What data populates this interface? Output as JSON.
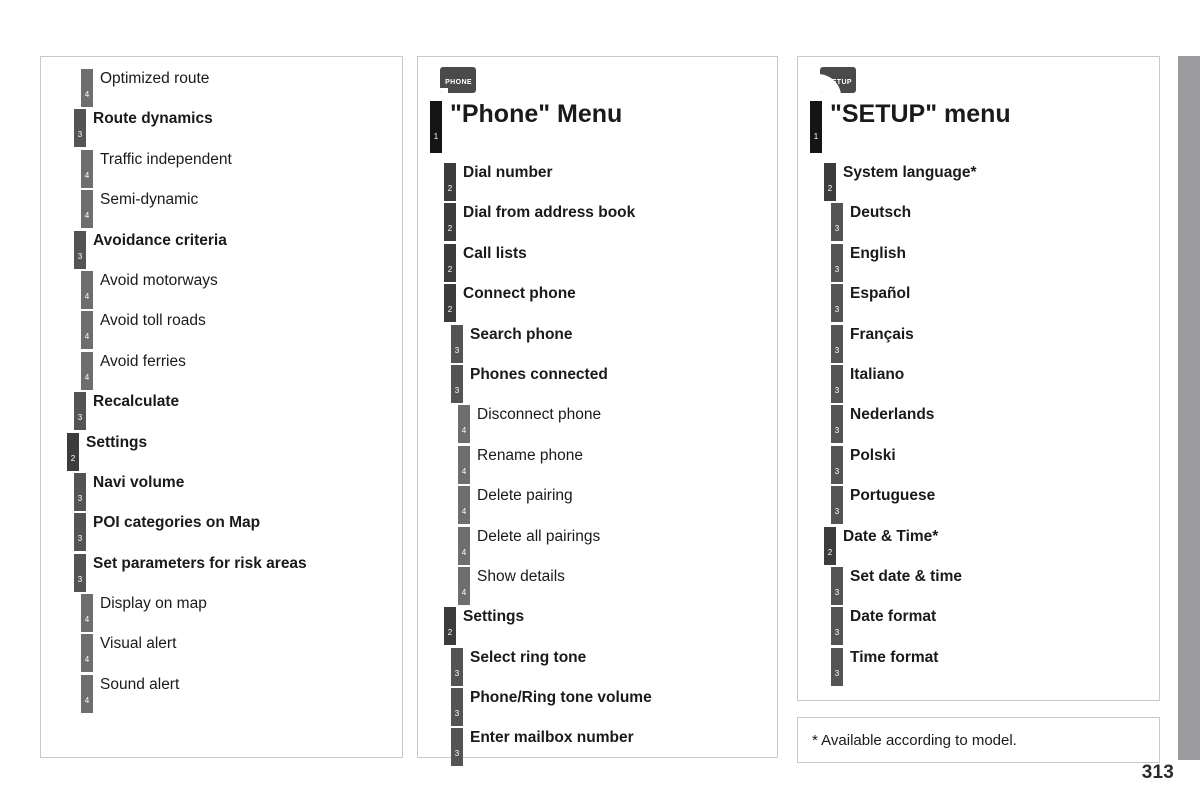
{
  "page": {
    "number": "313",
    "footnote": "* Available according to model."
  },
  "columns": [
    {
      "id": "navigation-continued",
      "icon": null,
      "rows": [
        {
          "level": 4,
          "label": "Optimized route"
        },
        {
          "level": 3,
          "label": "Route dynamics"
        },
        {
          "level": 4,
          "label": "Traffic independent"
        },
        {
          "level": 4,
          "label": "Semi-dynamic"
        },
        {
          "level": 3,
          "label": "Avoidance criteria"
        },
        {
          "level": 4,
          "label": "Avoid motorways"
        },
        {
          "level": 4,
          "label": "Avoid toll roads"
        },
        {
          "level": 4,
          "label": "Avoid ferries"
        },
        {
          "level": 3,
          "label": "Recalculate"
        },
        {
          "level": 2,
          "label": "Settings"
        },
        {
          "level": 3,
          "label": "Navi volume"
        },
        {
          "level": 3,
          "label": "POI categories on Map"
        },
        {
          "level": 3,
          "label": "Set parameters for risk areas"
        },
        {
          "level": 4,
          "label": "Display on map"
        },
        {
          "level": 4,
          "label": "Visual alert"
        },
        {
          "level": 4,
          "label": "Sound alert"
        }
      ]
    },
    {
      "id": "phone-menu",
      "icon": {
        "name": "phone-menu-icon",
        "glyph": "PHONE"
      },
      "rows": [
        {
          "level": 1,
          "label": "\"Phone\" Menu"
        },
        {
          "level": 2,
          "label": "Dial number"
        },
        {
          "level": 2,
          "label": "Dial from address book"
        },
        {
          "level": 2,
          "label": "Call lists"
        },
        {
          "level": 2,
          "label": "Connect phone"
        },
        {
          "level": 3,
          "label": "Search phone"
        },
        {
          "level": 3,
          "label": "Phones connected"
        },
        {
          "level": 4,
          "label": "Disconnect phone"
        },
        {
          "level": 4,
          "label": "Rename phone"
        },
        {
          "level": 4,
          "label": "Delete pairing"
        },
        {
          "level": 4,
          "label": "Delete all pairings"
        },
        {
          "level": 4,
          "label": "Show details"
        },
        {
          "level": 2,
          "label": "Settings"
        },
        {
          "level": 3,
          "label": "Select ring tone"
        },
        {
          "level": 3,
          "label": "Phone/Ring tone volume"
        },
        {
          "level": 3,
          "label": "Enter mailbox number"
        }
      ]
    },
    {
      "id": "setup-menu",
      "icon": {
        "name": "setup-menu-icon",
        "glyph": "SETUP"
      },
      "rows": [
        {
          "level": 1,
          "label": "\"SETUP\" menu"
        },
        {
          "level": 2,
          "label": "System language*"
        },
        {
          "level": 3,
          "label": "Deutsch"
        },
        {
          "level": 3,
          "label": "English"
        },
        {
          "level": 3,
          "label": "Español"
        },
        {
          "level": 3,
          "label": "Français"
        },
        {
          "level": 3,
          "label": "Italiano"
        },
        {
          "level": 3,
          "label": "Nederlands"
        },
        {
          "level": 3,
          "label": "Polski"
        },
        {
          "level": 3,
          "label": "Portuguese"
        },
        {
          "level": 2,
          "label": "Date & Time*"
        },
        {
          "level": 3,
          "label": "Set date & time"
        },
        {
          "level": 3,
          "label": "Date format"
        },
        {
          "level": 3,
          "label": "Time format"
        }
      ]
    }
  ],
  "level_colors": {
    "1": "#141414",
    "2": "#3c3c3c",
    "3": "#545454",
    "4": "#6e6e6e"
  },
  "level_numbers": {
    "1": "1",
    "2": "2",
    "3": "3",
    "4": "4"
  },
  "edge_bar_color": "#9b9ba0"
}
